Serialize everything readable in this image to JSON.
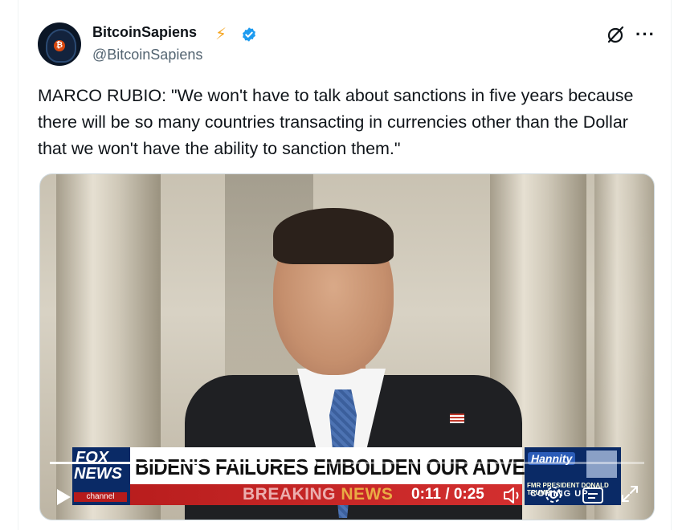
{
  "post": {
    "author_name": "BitcoinSapiens",
    "author_emoji": "⚡",
    "handle": "@BitcoinSapiens",
    "text": "MARCO RUBIO: \"We won't have to talk about sanctions in five years because there will be so many countries transacting in currencies other than the Dollar that we won't have the ability to sanction them.\"",
    "more_label": "···"
  },
  "video": {
    "chyron": "BIDEN'S FAILURES EMBOLDEN OUR ADVERSARIES",
    "breaking_word": "BREAKING",
    "news_word": "NEWS",
    "network_line1": "FOX",
    "network_line2": "NEWS",
    "network_line3": "channel",
    "promo_show": "Hannity",
    "promo_sub": "FMR PRESIDENT DONALD TRUMP",
    "promo_coming": "COMING UP",
    "current_time": "0:11",
    "duration": "0:25",
    "time_separator": " / ",
    "progress_fraction": 0.44
  },
  "colors": {
    "text_primary": "#0f1419",
    "text_secondary": "#536471",
    "verified_blue": "#1d9bf0",
    "bolt": "#f5a623"
  }
}
